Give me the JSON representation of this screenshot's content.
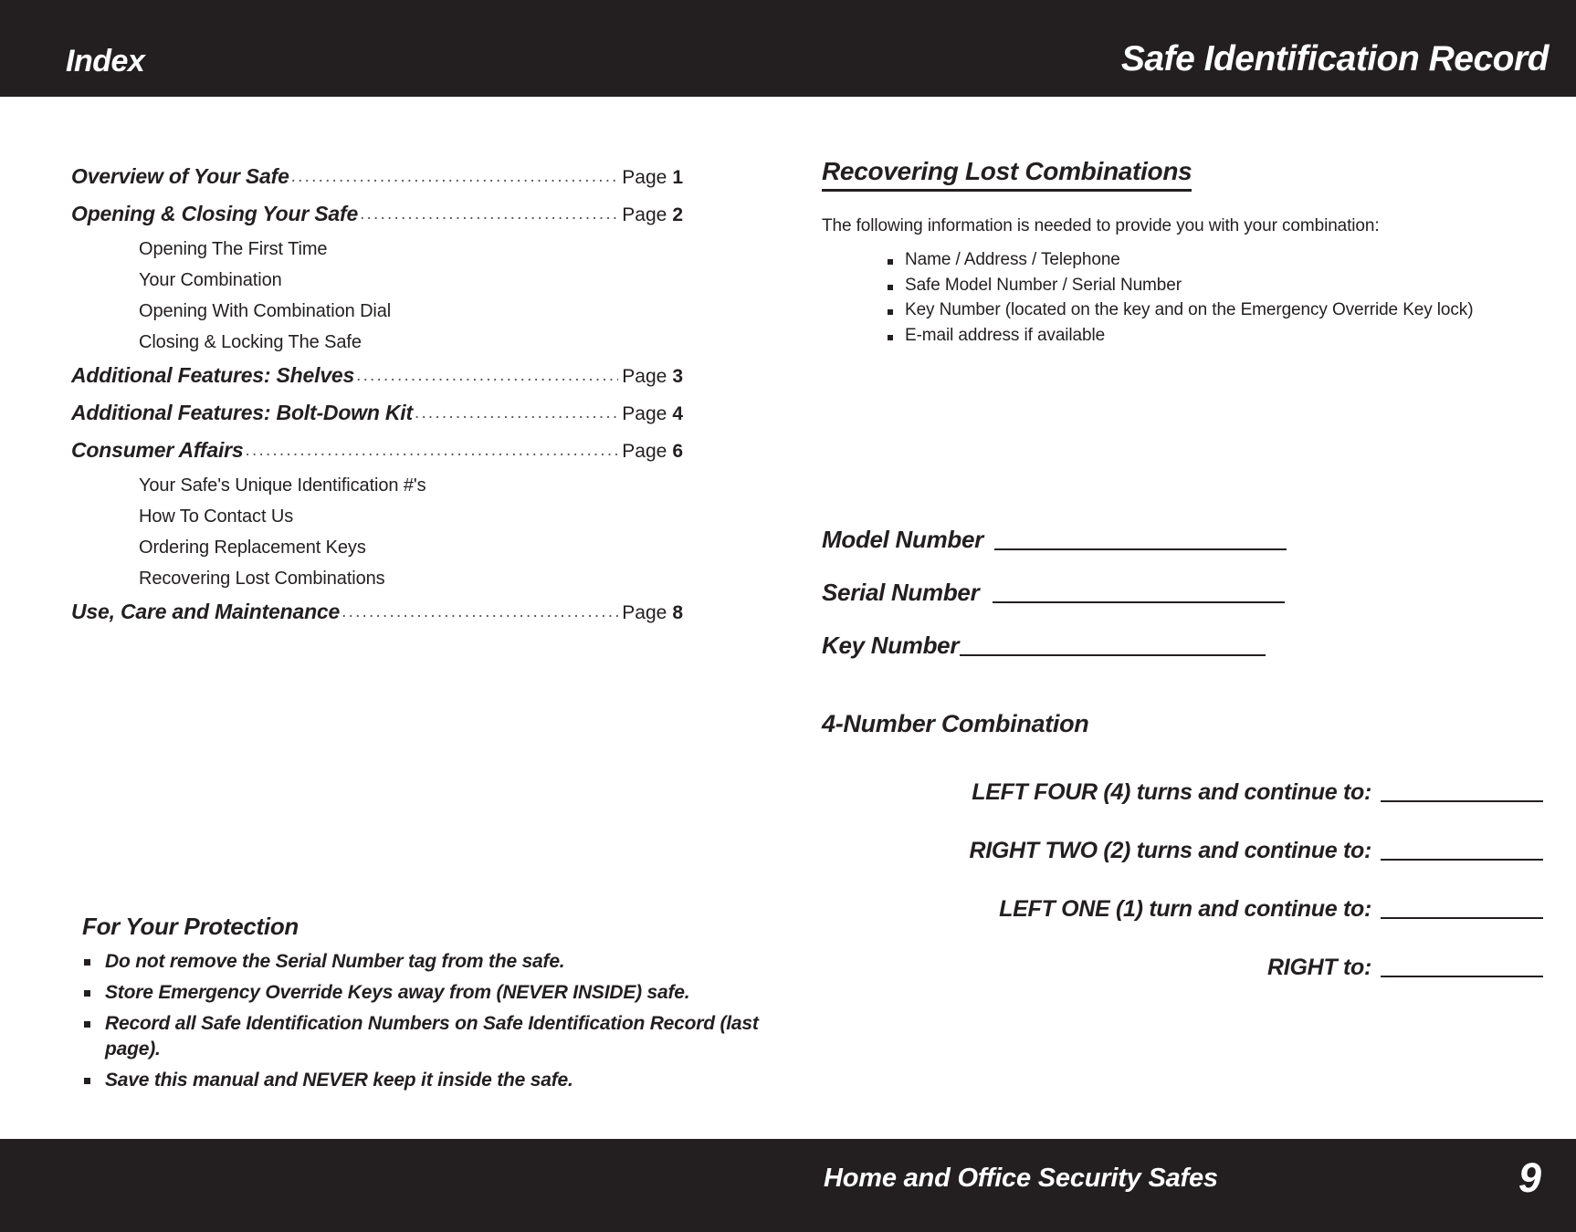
{
  "header": {
    "left_title": "Index",
    "right_title": "Safe Identification Record"
  },
  "footer": {
    "title": "Home and Office Security Safes",
    "page_number": "9"
  },
  "index": {
    "dots": "......................................................................................................",
    "page_label": "Page",
    "entries": [
      {
        "title": "Overview of Your Safe",
        "page": "1",
        "subitems": []
      },
      {
        "title": "Opening & Closing Your Safe",
        "page": "2",
        "subitems": [
          "Opening The First Time",
          "Your Combination",
          "Opening With Combination Dial",
          "Closing & Locking The Safe"
        ]
      },
      {
        "title": "Additional Features: Shelves",
        "page": "3",
        "subitems": []
      },
      {
        "title": "Additional Features: Bolt-Down Kit",
        "page": "4",
        "subitems": []
      },
      {
        "title": "Consumer Affairs",
        "page": "6",
        "subitems": [
          "Your Safe's Unique Identification #'s",
          "How To Contact Us",
          "Ordering Replacement Keys",
          "Recovering Lost Combinations"
        ]
      },
      {
        "title": "Use, Care and Maintenance",
        "page": "8",
        "subitems": []
      }
    ]
  },
  "protection": {
    "title": "For Your Protection",
    "items": [
      "Do not remove the Serial Number tag from the safe.",
      "Store Emergency Override Keys away from (NEVER INSIDE) safe.",
      "Record all Safe Identification Numbers on Safe Identification Record (last page).",
      "Save this manual and NEVER keep it inside the safe."
    ]
  },
  "recovering": {
    "heading": "Recovering Lost Combinations",
    "intro": "The following information is needed to provide you with your combination:",
    "bullets": [
      "Name / Address / Telephone",
      "Safe Model Number / Serial Number",
      "Key Number (located on the key and on the Emergency Override Key lock)",
      "E-mail address if available"
    ]
  },
  "number_fields": [
    {
      "label": "Model Number",
      "value": ""
    },
    {
      "label": "Serial Number",
      "value": ""
    },
    {
      "label": "Key Number",
      "value": ""
    }
  ],
  "combination": {
    "title": "4-Number Combination",
    "steps": [
      {
        "label": "LEFT FOUR (4) turns and continue to:",
        "value": ""
      },
      {
        "label": "RIGHT TWO (2) turns and continue to:",
        "value": ""
      },
      {
        "label": "LEFT ONE (1) turn and continue to:",
        "value": ""
      },
      {
        "label": "RIGHT to:",
        "value": ""
      }
    ]
  },
  "colors": {
    "bar": "#231f20",
    "text": "#231f20",
    "dots": "#58585b",
    "background": "#ffffff"
  }
}
